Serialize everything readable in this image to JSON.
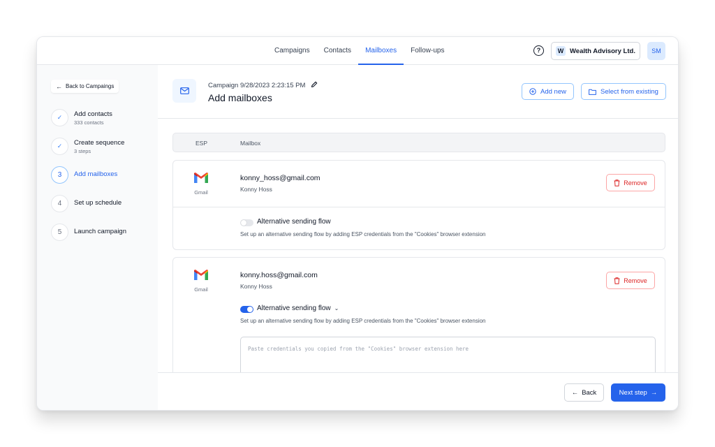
{
  "nav": {
    "tabs": [
      {
        "label": "Campaigns",
        "active": false
      },
      {
        "label": "Contacts",
        "active": false
      },
      {
        "label": "Mailboxes",
        "active": true
      },
      {
        "label": "Follow-ups",
        "active": false
      }
    ],
    "help_icon": "?",
    "workspace": {
      "initial": "W",
      "name": "Wealth Advisory Ltd."
    },
    "avatar": "SM"
  },
  "sidebar": {
    "back_label": "Back to Campaings",
    "steps": [
      {
        "marker": "✓",
        "label": "Add contacts",
        "sub": "333 contacts",
        "state": "done"
      },
      {
        "marker": "✓",
        "label": "Create sequence",
        "sub": "3 steps",
        "state": "done"
      },
      {
        "marker": "3",
        "label": "Add mailboxes",
        "sub": "",
        "state": "active"
      },
      {
        "marker": "4",
        "label": "Set up schedule",
        "sub": "",
        "state": "pending"
      },
      {
        "marker": "5",
        "label": "Launch campaign",
        "sub": "",
        "state": "pending"
      }
    ]
  },
  "header": {
    "campaign_meta": "Campaign 9/28/2023 2:23:15 PM",
    "title": "Add mailboxes",
    "add_new_label": "Add new",
    "select_existing_label": "Select from existing"
  },
  "table": {
    "col_esp": "ESP",
    "col_mailbox": "Mailbox"
  },
  "mailboxes": [
    {
      "esp": "Gmail",
      "email": "konny_hoss@gmail.com",
      "name": "Konny Hoss",
      "remove_label": "Remove",
      "alt_flow_title": "Alternative sending flow",
      "alt_flow_enabled": false,
      "alt_flow_desc": "Set up an alternative sending flow by adding ESP credentials from the \"Cookies\" browser extension"
    },
    {
      "esp": "Gmail",
      "email": "konny.hoss@gmail.com",
      "name": "Konny Hoss",
      "remove_label": "Remove",
      "alt_flow_title": "Alternative sending flow",
      "alt_flow_enabled": true,
      "alt_flow_desc": "Set up an alternative sending flow by adding ESP credentials from the \"Cookies\" browser extension",
      "credentials_placeholder": "Paste credentials you copied from the \"Cookies\" browser extension here"
    }
  ],
  "footer": {
    "back_label": "Back",
    "next_label": "Next step"
  },
  "colors": {
    "accent": "#2563eb",
    "danger": "#dc2626",
    "sidebar_bg": "#f9fafb"
  }
}
